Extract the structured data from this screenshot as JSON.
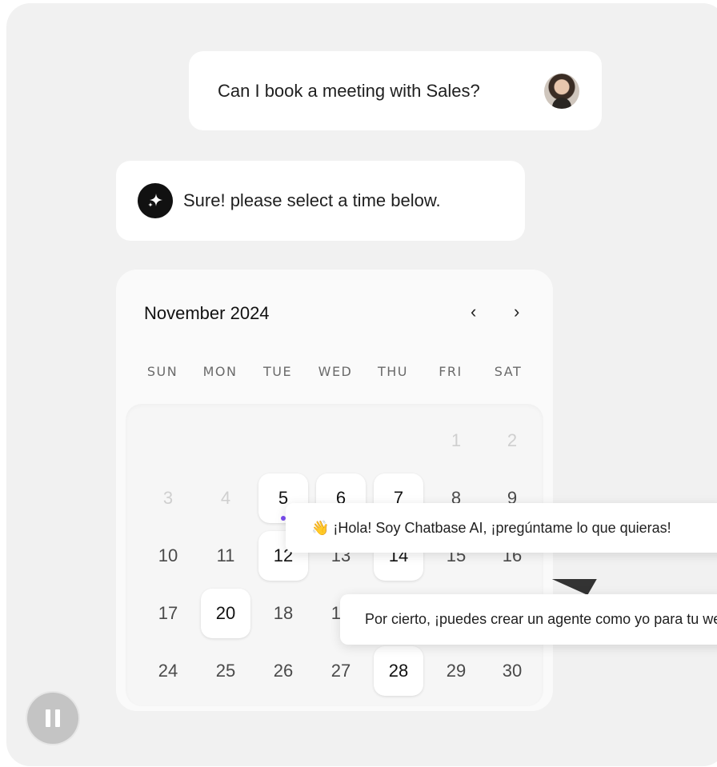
{
  "chat": {
    "user_message": "Can I book a meeting with Sales?",
    "bot_message": "Sure! please select a time below."
  },
  "calendar": {
    "month_label": "November 2024",
    "prev_icon": "‹",
    "next_icon": "›",
    "weekdays": [
      "SUN",
      "MON",
      "TUE",
      "WED",
      "THU",
      "FRI",
      "SAT"
    ],
    "days": [
      {
        "label": "1",
        "state": "faint"
      },
      {
        "label": "2",
        "state": "faint"
      },
      {
        "label": "3",
        "state": "faint"
      },
      {
        "label": "4",
        "state": "faint"
      },
      {
        "label": "5",
        "state": "available"
      },
      {
        "label": "6",
        "state": "available"
      },
      {
        "label": "7",
        "state": "available"
      },
      {
        "label": "8",
        "state": "normal"
      },
      {
        "label": "9",
        "state": "normal"
      },
      {
        "label": "10",
        "state": "normal"
      },
      {
        "label": "11",
        "state": "normal"
      },
      {
        "label": "12",
        "state": "available"
      },
      {
        "label": "13",
        "state": "normal"
      },
      {
        "label": "14",
        "state": "available"
      },
      {
        "label": "15",
        "state": "normal"
      },
      {
        "label": "16",
        "state": "normal"
      },
      {
        "label": "17",
        "state": "normal"
      },
      {
        "label": "20",
        "state": "available"
      },
      {
        "label": "18",
        "state": "normal"
      },
      {
        "label": "19",
        "state": "normal"
      },
      {
        "label": "24",
        "state": "normal"
      },
      {
        "label": "25",
        "state": "normal"
      },
      {
        "label": "26",
        "state": "normal"
      },
      {
        "label": "27",
        "state": "normal"
      },
      {
        "label": "28",
        "state": "available"
      },
      {
        "label": "29",
        "state": "normal"
      },
      {
        "label": "30",
        "state": "normal"
      }
    ]
  },
  "popups": {
    "greeting": "👋 ¡Hola! Soy Chatbase AI, ¡pregúntame lo que quieras!",
    "followup": "Por cierto, ¡puedes crear un agente como yo para tu web!"
  },
  "controls": {
    "pause_icon": "pause-icon"
  },
  "colors": {
    "background": "#f1f1f1",
    "bubble": "#ffffff",
    "accent_dot": "#7a4cf0",
    "bot_icon": "#111111"
  }
}
